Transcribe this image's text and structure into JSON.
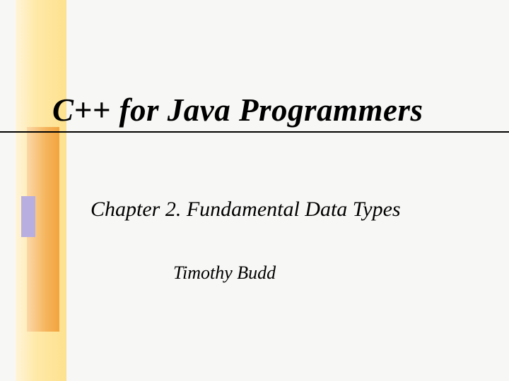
{
  "slide": {
    "title": "C++ for Java Programmers",
    "subtitle": "Chapter 2. Fundamental Data Types",
    "author": "Timothy Budd"
  }
}
